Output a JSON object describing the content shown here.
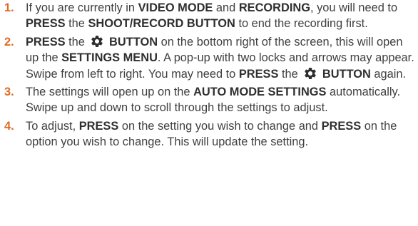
{
  "steps": [
    {
      "number": "1.",
      "t1": "If you are currently in ",
      "b1": "VIDEO MODE",
      "t2": " and ",
      "b2": "RECORDING",
      "t3": ", you will need to ",
      "b3": "PRESS",
      "t4": " the ",
      "b4": "SHOOT/RECORD BUTTON",
      "t5": " to end the recording first."
    },
    {
      "number": "2.",
      "b1": "PRESS",
      "t1": " the ",
      "icon": "gear-icon",
      "b2": " BUTTON",
      "t2": " on the bottom right of the screen, this will open up the ",
      "b3": "SETTINGS MENU",
      "t3": ". A pop-up with two locks and arrows may appear. Swipe from left to right. You may need to ",
      "b4": "PRESS",
      "t4": " the ",
      "icon2": "gear-icon",
      "b5": " BUTTON",
      "t5": " again."
    },
    {
      "number": "3.",
      "t1": "The settings will open up on the ",
      "b1": "AUTO MODE SETTINGS",
      "t2": " automatically. Swipe up and down to scroll through the settings to adjust."
    },
    {
      "number": "4.",
      "t1": "To adjust, ",
      "b1": "PRESS",
      "t2": " on the setting you wish to change and ",
      "b2": "PRESS",
      "t3": " on the option you wish to change. This will update the setting."
    }
  ],
  "colors": {
    "number": "#e06a23",
    "text": "#3f3f3f",
    "icon": "#2f2f2f"
  }
}
